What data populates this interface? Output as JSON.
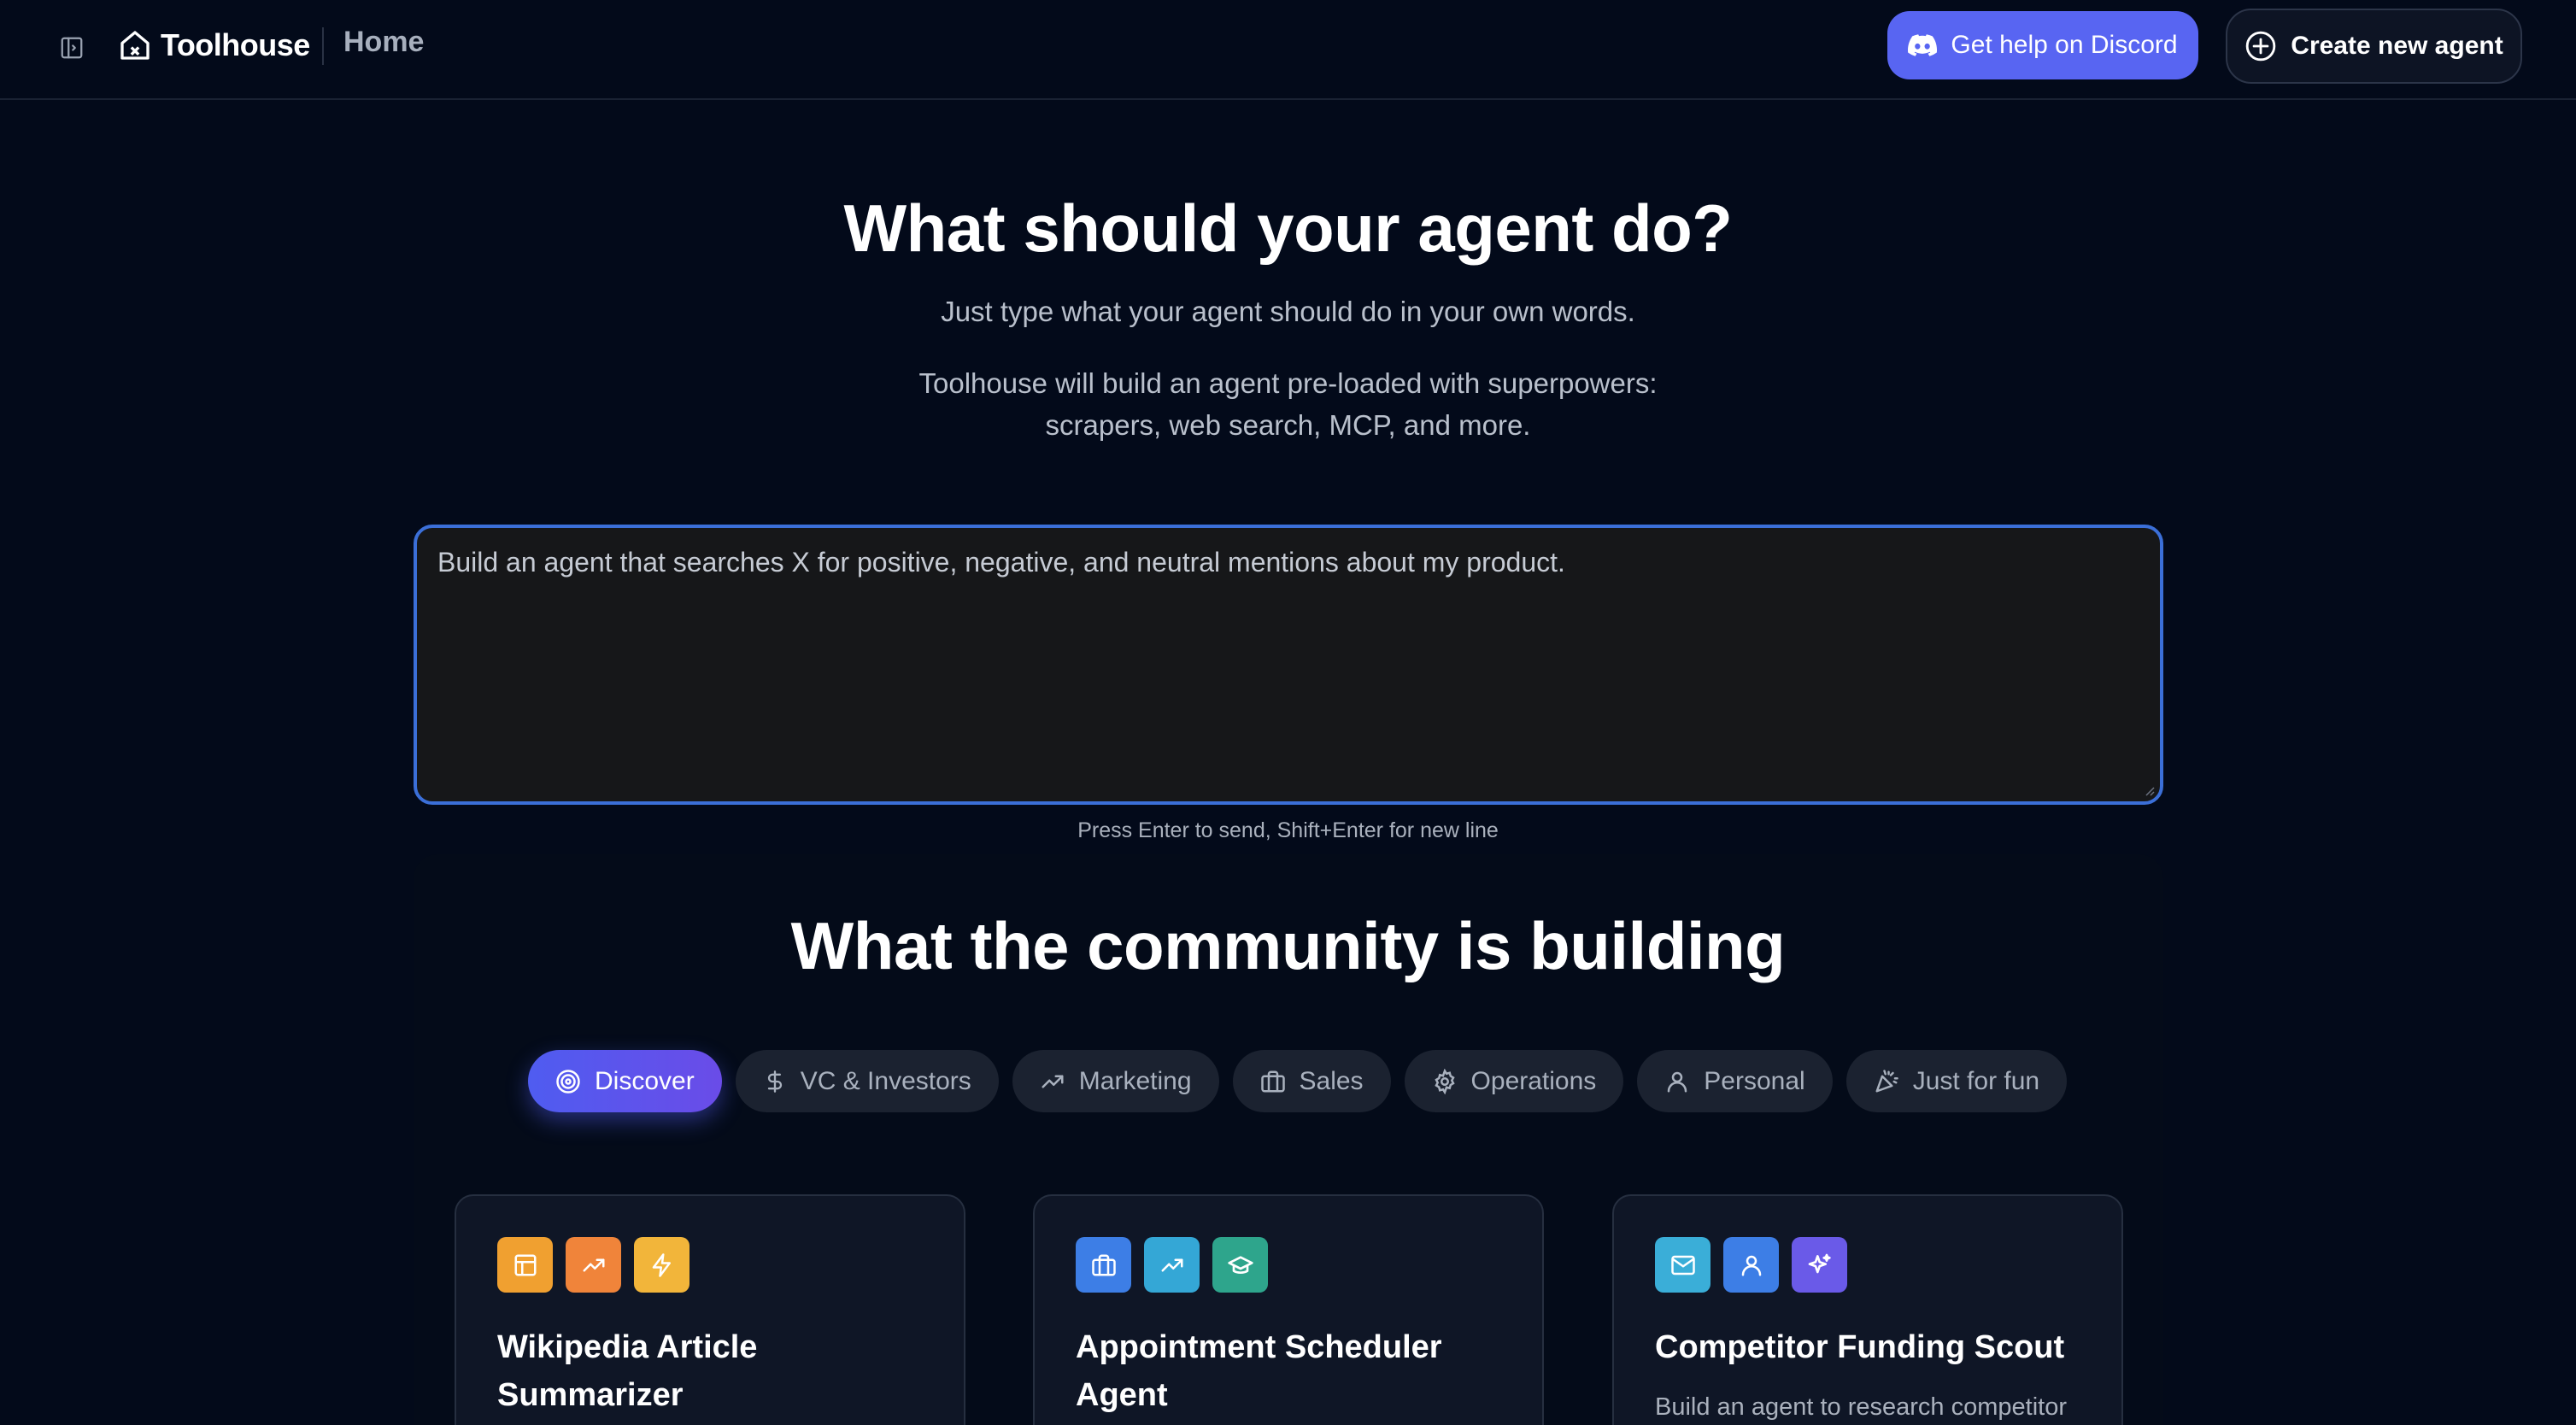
{
  "header": {
    "app_name": "Toolhouse",
    "breadcrumb": "Home",
    "discord_label": "Get help on Discord",
    "create_label": "Create new agent"
  },
  "hero": {
    "title": "What should your agent do?",
    "subtitle": "Just type what your agent should do in your own words.",
    "description_line1": "Toolhouse will build an agent pre-loaded with superpowers:",
    "description_line2": "scrapers, web search, MCP, and more."
  },
  "prompt": {
    "value": "Build an agent that searches X for positive, negative, and neutral mentions about my product.",
    "hint": "Press Enter to send, Shift+Enter for new line"
  },
  "community": {
    "title": "What the community is building",
    "tabs": [
      {
        "label": "Discover",
        "icon": "target-icon",
        "active": true
      },
      {
        "label": "VC & Investors",
        "icon": "dollar-icon",
        "active": false
      },
      {
        "label": "Marketing",
        "icon": "trending-up-icon",
        "active": false
      },
      {
        "label": "Sales",
        "icon": "briefcase-icon",
        "active": false
      },
      {
        "label": "Operations",
        "icon": "gear-icon",
        "active": false
      },
      {
        "label": "Personal",
        "icon": "user-icon",
        "active": false
      },
      {
        "label": "Just for fun",
        "icon": "party-popper-icon",
        "active": false
      }
    ],
    "cards": [
      {
        "title_line1": "Wikipedia Article",
        "title_line2": "Summarizer",
        "description": "",
        "icons": [
          {
            "name": "layout-icon",
            "color": "#f0a030"
          },
          {
            "name": "trending-up-icon",
            "color": "#f0843a"
          },
          {
            "name": "zap-icon",
            "color": "#f2b53a"
          }
        ]
      },
      {
        "title_line1": "Appointment Scheduler",
        "title_line2": "Agent",
        "description": "",
        "icons": [
          {
            "name": "briefcase-icon",
            "color": "#3d7ee6"
          },
          {
            "name": "trending-up-icon",
            "color": "#34a7d6"
          },
          {
            "name": "graduation-cap-icon",
            "color": "#2ea58c"
          }
        ]
      },
      {
        "title_line1": "Competitor Funding Scout",
        "title_line2": "",
        "description": "Build an agent to research competitor",
        "icons": [
          {
            "name": "mail-icon",
            "color": "#3aaed8"
          },
          {
            "name": "user-icon",
            "color": "#3d7ee6"
          },
          {
            "name": "sparkles-icon",
            "color": "#6a5ae8"
          }
        ]
      }
    ]
  },
  "colors": {
    "background": "#030a1a",
    "accent": "#5865f2",
    "prompt_border": "#3b6fd8",
    "tab_active_start": "#4f5cf0",
    "tab_active_end": "#6a4ce8"
  }
}
